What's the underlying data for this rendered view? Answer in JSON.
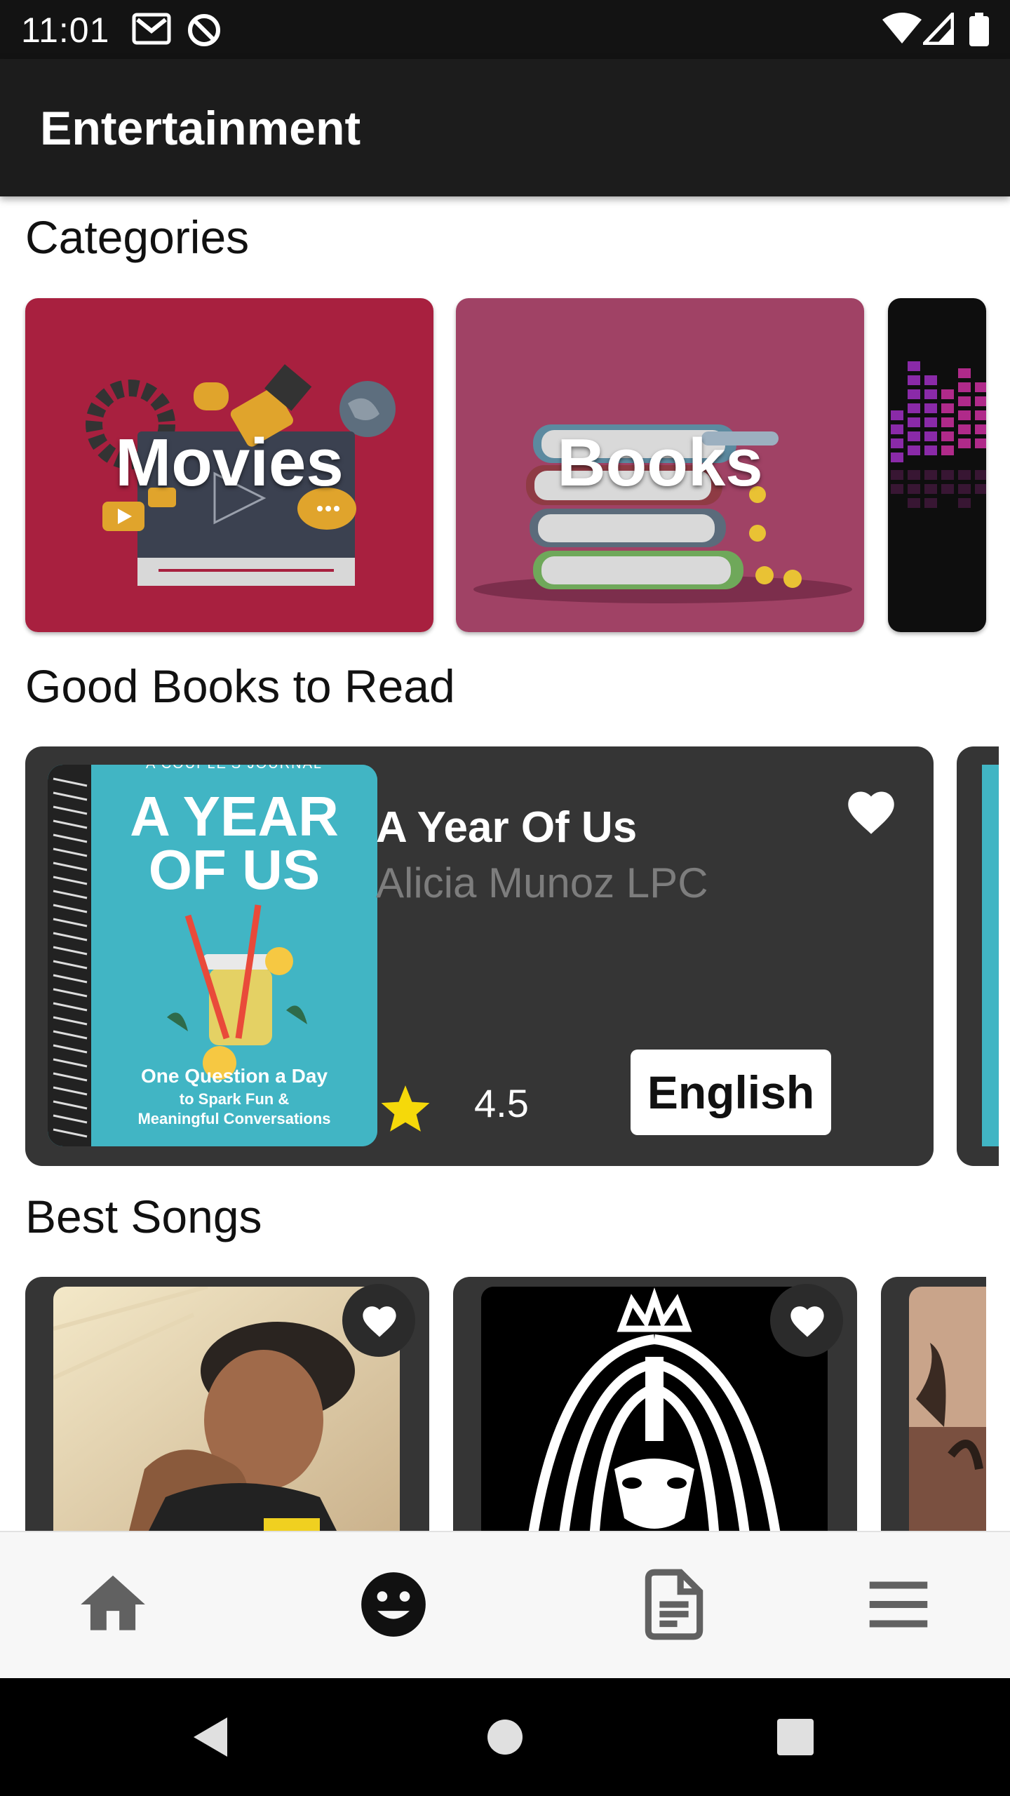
{
  "status_bar": {
    "time": "11:01",
    "icons": [
      "gmail-icon",
      "no-disturb-icon",
      "wifi-icon",
      "signal-icon",
      "battery-icon"
    ]
  },
  "app_bar": {
    "title": "Entertainment"
  },
  "categories": {
    "heading": "Categories",
    "items": [
      {
        "label": "Movies",
        "color": "#a8203f"
      },
      {
        "label": "Books",
        "color": "#a04265"
      },
      {
        "label": "",
        "color": "#111111"
      }
    ]
  },
  "good_books": {
    "heading": "Good Books to Read",
    "items": [
      {
        "title": "A Year Of Us",
        "author": "Alicia Munoz LPC",
        "rating": "4.5",
        "language": "English",
        "favorite": true,
        "cover": {
          "kicker": "A COUPLE'S JOURNAL",
          "title_line1": "A YEAR",
          "title_line2": "OF US",
          "subtitle_line1": "One Question a Day",
          "subtitle_line2": "to Spark Fun &",
          "subtitle_line3": "Meaningful Conversations",
          "color": "#41b5c4"
        }
      }
    ]
  },
  "best_songs": {
    "heading": "Best Songs",
    "items": [
      {
        "favorite": true
      },
      {
        "favorite": true
      },
      {
        "favorite": false
      }
    ]
  },
  "bottom_nav": {
    "items": [
      {
        "icon": "home-icon",
        "active": false
      },
      {
        "icon": "smiley-icon",
        "active": true
      },
      {
        "icon": "document-icon",
        "active": false
      },
      {
        "icon": "menu-icon",
        "active": false
      }
    ]
  },
  "system_nav": {
    "icons": [
      "back-icon",
      "home-circle-icon",
      "recents-icon"
    ]
  },
  "colors": {
    "app_bar": "#1c1c1c",
    "card": "#353535",
    "star": "#f5d90a",
    "author": "#7d7d7d"
  }
}
